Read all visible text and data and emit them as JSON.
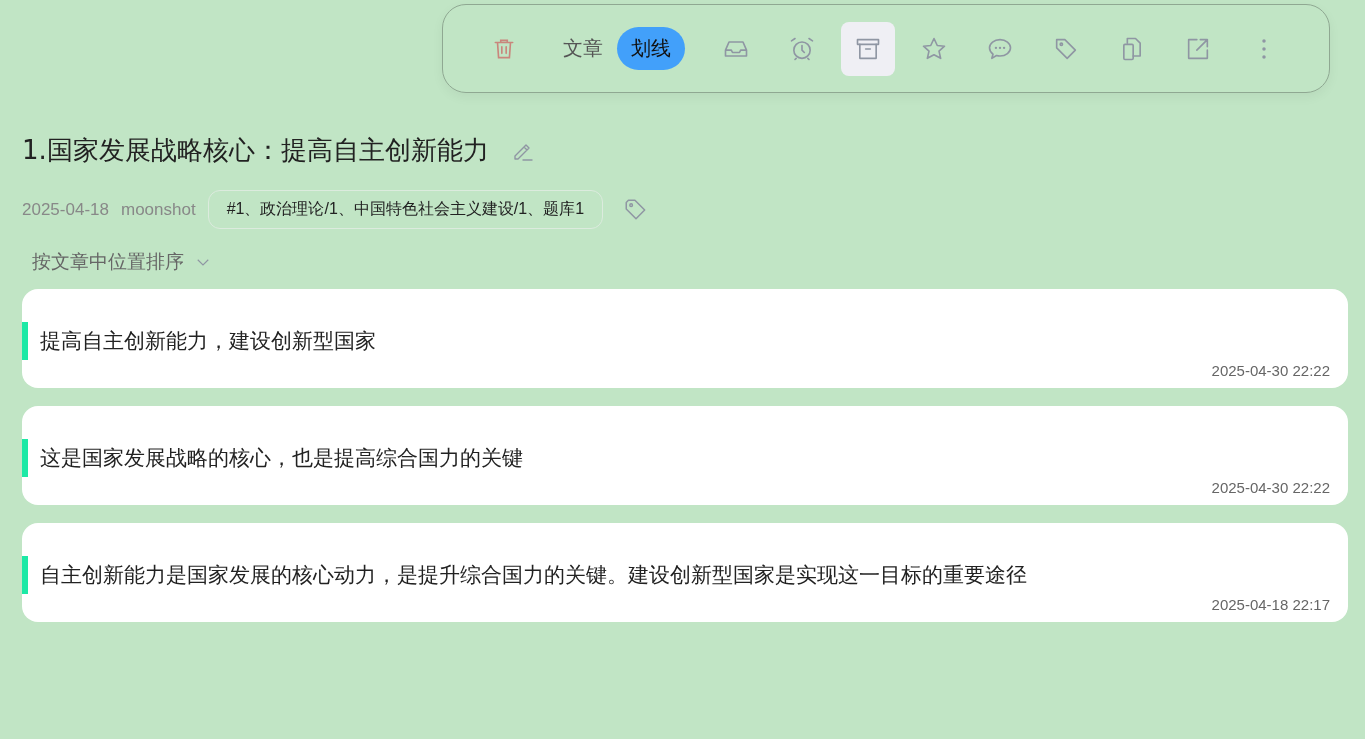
{
  "toolbar": {
    "delete": {
      "kind": "trash"
    },
    "tabs": [
      {
        "label": "文章",
        "selected": false
      },
      {
        "label": "划线",
        "selected": true
      }
    ],
    "actions": [
      {
        "kind": "inbox",
        "selected": false
      },
      {
        "kind": "alarm",
        "selected": false
      },
      {
        "kind": "archive",
        "selected": true
      },
      {
        "kind": "star",
        "selected": false
      },
      {
        "kind": "comment",
        "selected": false
      },
      {
        "kind": "tag",
        "selected": false
      },
      {
        "kind": "copy",
        "selected": false
      },
      {
        "kind": "external",
        "selected": false
      },
      {
        "kind": "more",
        "selected": false
      }
    ]
  },
  "article": {
    "title": "1.国家发展战略核心：提高自主创新能力",
    "date": "2025-04-18",
    "author": "moonshot",
    "tag": "#1、政治理论/1、中国特色社会主义建设/1、题库1"
  },
  "sort": {
    "label": "按文章中位置排序"
  },
  "highlights": [
    {
      "text": "提高自主创新能力，建设创新型国家",
      "time": "2025-04-30 22:22",
      "color": "#1de9a6"
    },
    {
      "text": "这是国家发展战略的核心，也是提高综合国力的关键",
      "time": "2025-04-30 22:22",
      "color": "#1de9a6"
    },
    {
      "text": "自主创新能力是国家发展的核心动力，是提升综合国力的关键。建设创新型国家是实现这一目标的重要途径",
      "time": "2025-04-18 22:17",
      "color": "#1de9a6"
    }
  ]
}
